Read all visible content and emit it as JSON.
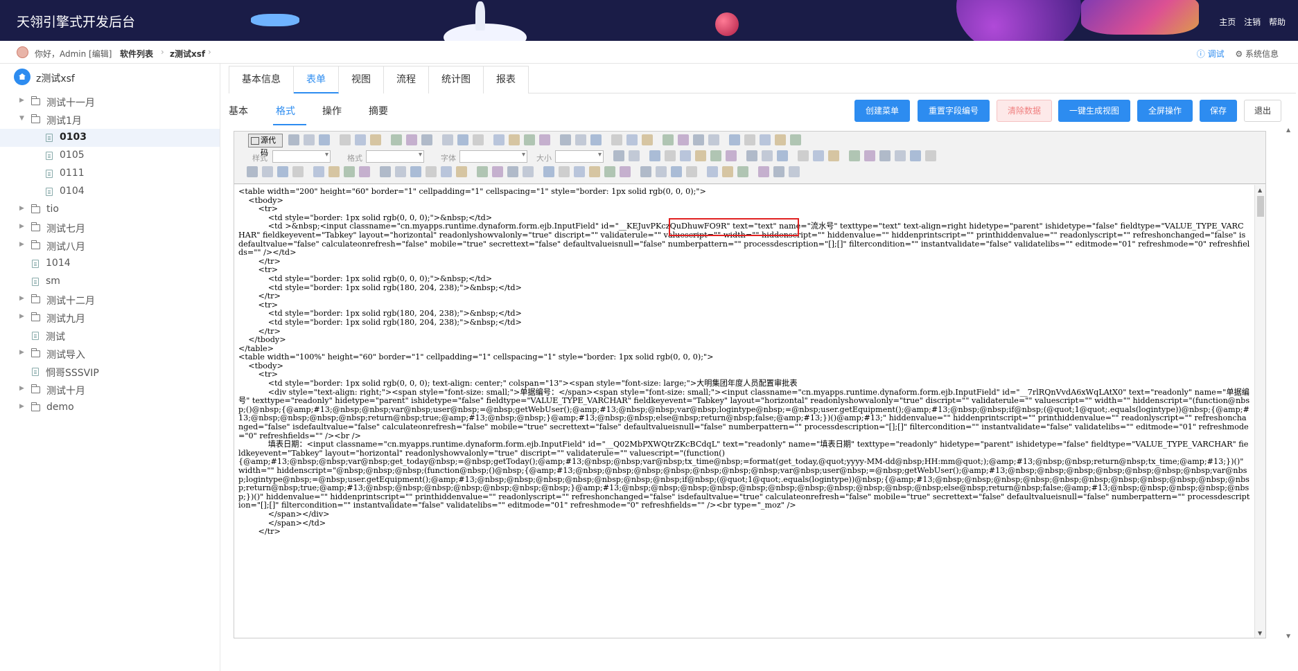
{
  "header": {
    "title": "天翎引擎式开发后台",
    "nav": [
      "主页",
      "注销",
      "帮助"
    ]
  },
  "breadcrumb": {
    "greeting": "你好，Admin [编辑]",
    "items": [
      "软件列表",
      "z测试xsf"
    ],
    "debug_label": "ⓘ 调试",
    "system_label": "⚙ 系统信息"
  },
  "sidebar": {
    "root": "z测试xsf",
    "items": [
      {
        "label": "测试十一月",
        "kind": "folder",
        "expanded": false
      },
      {
        "label": "测试1月",
        "kind": "folder",
        "expanded": true
      },
      {
        "label": "0103",
        "kind": "file",
        "child": true,
        "selected": true
      },
      {
        "label": "0105",
        "kind": "file",
        "child": true
      },
      {
        "label": "0111",
        "kind": "file",
        "child": true
      },
      {
        "label": "0104",
        "kind": "file",
        "child": true
      },
      {
        "label": "tio",
        "kind": "folder",
        "expanded": false
      },
      {
        "label": "测试七月",
        "kind": "folder",
        "expanded": false
      },
      {
        "label": "测试八月",
        "kind": "folder",
        "expanded": false
      },
      {
        "label": "1014",
        "kind": "file"
      },
      {
        "label": "sm",
        "kind": "file"
      },
      {
        "label": "测试十二月",
        "kind": "folder",
        "expanded": false
      },
      {
        "label": "测试九月",
        "kind": "folder",
        "expanded": false
      },
      {
        "label": "测试",
        "kind": "file"
      },
      {
        "label": "测试导入",
        "kind": "folder",
        "expanded": false
      },
      {
        "label": "恫哥SSSVIP",
        "kind": "file"
      },
      {
        "label": "测试十月",
        "kind": "folder",
        "expanded": false
      },
      {
        "label": "demo",
        "kind": "folder",
        "expanded": false
      }
    ]
  },
  "tabs": [
    "基本信息",
    "表单",
    "视图",
    "流程",
    "统计图",
    "报表"
  ],
  "active_tab": 1,
  "subtabs": [
    "基本",
    "格式",
    "操作",
    "摘要"
  ],
  "active_subtab": 1,
  "actions": {
    "create_menu": "创建菜单",
    "reset_field_no": "重置字段编号",
    "clear_data": "清除数据",
    "gen_view": "一键生成视图",
    "fullscreen": "全屏操作",
    "save": "保存",
    "exit": "退出"
  },
  "editor": {
    "source_button": "源代码",
    "style_label": "样式",
    "format_label": "格式",
    "font_label": "字体",
    "size_label": "大小",
    "code": "<table width=\"200\" height=\"60\" border=\"1\" cellpadding=\"1\" cellspacing=\"1\" style=\"border: 1px solid rgb(0, 0, 0);\">\n    <tbody>\n        <tr>\n            <td style=\"border: 1px solid rgb(0, 0, 0);\">&nbsp;</td>\n            <td >&nbsp;<input classname=\"cn.myapps.runtime.dynaform.form.ejb.InputField\" id=\"__KEJuvPKczQuDhuwFO9R\" text=\"text\" name=\"流水号\" texttype=\"text\" text-align=right hidetype=\"parent\" ishidetype=\"false\" fieldtype=\"VALUE_TYPE_VARCHAR\" fieldkeyevent=\"Tabkey\" layout=\"horizontal\" readonlyshowvalonly=\"true\" discript=\"\" validaterule=\"\" valuescript=\"\" width=\"\" hiddenscript=\"\" hiddenvalue=\"\" hiddenprintscript=\"\" printhiddenvalue=\"\" readonlyscript=\"\" refreshonchanged=\"false\" isdefaultvalue=\"false\" calculateonrefresh=\"false\" mobile=\"true\" secrettext=\"false\" defaultvalueisnull=\"false\" numberpattern=\"\" processdescription=\"[];[]\" filtercondition=\"\" instantvalidate=\"false\" validatelibs=\"\" editmode=\"01\" refreshmode=\"0\" refreshfields=\"\" /></td>\n        </tr>\n        <tr>\n            <td style=\"border: 1px solid rgb(0, 0, 0);\">&nbsp;</td>\n            <td style=\"border: 1px solid rgb(180, 204, 238);\">&nbsp;</td>\n        </tr>\n        <tr>\n            <td style=\"border: 1px solid rgb(180, 204, 238);\">&nbsp;</td>\n            <td style=\"border: 1px solid rgb(180, 204, 238);\">&nbsp;</td>\n        </tr>\n    </tbody>\n</table>\n<table width=\"100%\" height=\"60\" border=\"1\" cellpadding=\"1\" cellspacing=\"1\" style=\"border: 1px solid rgb(0, 0, 0);\">\n    <tbody>\n        <tr>\n            <td style=\"border: 1px solid rgb(0, 0, 0); text-align: center;\" colspan=\"13\"><span style=\"font-size: large;\">大明集团年度人员配置审批表\n            <div style=\"text-align: right;\"><span style=\"font-size: small;\">单据编号：</span><span style=\"font-size: small;\"><input classname=\"cn.myapps.runtime.dynaform.form.ejb.InputField\" id=\"__7rlRQnVvdA6xWqLAtX0\" text=\"readonly\" name=\"单据编号\" texttype=\"readonly\" hidetype=\"parent\" ishidetype=\"false\" fieldtype=\"VALUE_TYPE_VARCHAR\" fieldkeyevent=\"Tabkey\" layout=\"horizontal\" readonlyshowvalonly=\"true\" discript=\"\" validaterule=\"\" valuescript=\"\" width=\"\" hiddenscript=\"(function@nbsp;()@nbsp;{@amp;#13;@nbsp;@nbsp;var@nbsp;user@nbsp;=@nbsp;getWebUser();@amp;#13;@nbsp;@nbsp;var@nbsp;logintype@nbsp;=@nbsp;user.getEquipment();@amp;#13;@nbsp;@nbsp;if@nbsp;(@quot;1@quot;.equals(logintype))@nbsp;{@amp;#13;@nbsp;@nbsp;@nbsp;@nbsp;return@nbsp;true;@amp;#13;@nbsp;@nbsp;}@amp;#13;@nbsp;@nbsp;else@nbsp;return@nbsp;false;@amp;#13;})()@amp;#13;\" hiddenvalue=\"\" hiddenprintscript=\"\" printhiddenvalue=\"\" readonlyscript=\"\" refreshonchanged=\"false\" isdefaultvalue=\"false\" calculateonrefresh=\"false\" mobile=\"true\" secrettext=\"false\" defaultvalueisnull=\"false\" numberpattern=\"\" processdescription=\"[];[]\" filtercondition=\"\" instantvalidate=\"false\" validatelibs=\"\" editmode=\"01\" refreshmode=\"0\" refreshfields=\"\" /><br />\n            填表日期：<input classname=\"cn.myapps.runtime.dynaform.form.ejb.InputField\" id=\"__Q02MbPXWQtrZKcBCdqL\" text=\"readonly\" name=\"填表日期\" texttype=\"readonly\" hidetype=\"parent\" ishidetype=\"false\" fieldtype=\"VALUE_TYPE_VARCHAR\" fieldkeyevent=\"Tabkey\" layout=\"horizontal\" readonlyshowvalonly=\"true\" discript=\"\" validaterule=\"\" valuescript=\"(function()\n{@amp;#13;@nbsp;@nbsp;var@nbsp;get_today@nbsp;=@nbsp;getToday();@amp;#13;@nbsp;@nbsp;var@nbsp;tx_time@nbsp;=format(get_today,@quot;yyyy-MM-dd@nbsp;HH:mm@quot;);@amp;#13;@nbsp;@nbsp;return@nbsp;tx_time;@amp;#13;})()\" width=\"\" hiddenscript=\"@nbsp;@nbsp;@nbsp;(function@nbsp;()@nbsp;{@amp;#13;@nbsp;@nbsp;@nbsp;@nbsp;@nbsp;@nbsp;@nbsp;var@nbsp;user@nbsp;=@nbsp;getWebUser();@amp;#13;@nbsp;@nbsp;@nbsp;@nbsp;@nbsp;@nbsp;@nbsp;var@nbsp;logintype@nbsp;=@nbsp;user.getEquipment();@amp;#13;@nbsp;@nbsp;@nbsp;@nbsp;@nbsp;@nbsp;@nbsp;if@nbsp;(@quot;1@quot;.equals(logintype))@nbsp;{@amp;#13;@nbsp;@nbsp;@nbsp;@nbsp;@nbsp;@nbsp;@nbsp;@nbsp;@nbsp;@nbsp;@nbsp;return@nbsp;true;@amp;#13;@nbsp;@nbsp;@nbsp;@nbsp;@nbsp;@nbsp;@nbsp;}@amp;#13;@nbsp;@nbsp;@nbsp;@nbsp;@nbsp;@nbsp;@nbsp;@nbsp;@nbsp;@nbsp;@nbsp;else@nbsp;return@nbsp;false;@amp;#13;@nbsp;@nbsp;@nbsp;@nbsp;@nbsp;})()\" hiddenvalue=\"\" hiddenprintscript=\"\" printhiddenvalue=\"\" readonlyscript=\"\" refreshonchanged=\"false\" isdefaultvalue=\"true\" calculateonrefresh=\"false\" mobile=\"true\" secrettext=\"false\" defaultvalueisnull=\"false\" numberpattern=\"\" processdescription=\"[];[]\" filtercondition=\"\" instantvalidate=\"false\" validatelibs=\"\" editmode=\"01\" refreshmode=\"0\" refreshfields=\"\" /><br type=\"_moz\" />\n            </span></div>\n            </span></td>\n        </tr>"
  },
  "colors": {
    "accent": "#2d8cf0",
    "header_bg": "#1a1c47",
    "highlight_box": "#e02020"
  }
}
